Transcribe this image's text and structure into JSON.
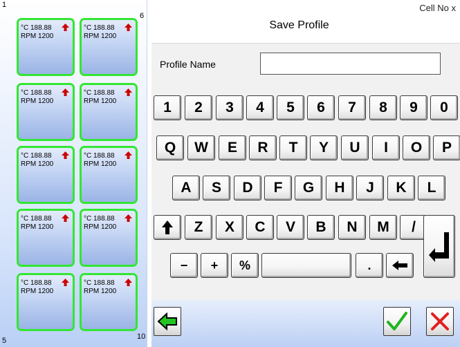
{
  "left_panel": {
    "corner_labels": {
      "top_left": "1",
      "top_right": "6",
      "bottom_left": "5",
      "bottom_right": "10"
    },
    "cells": [
      {
        "temp": "°C 188.88",
        "rpm": "RPM 1200"
      },
      {
        "temp": "°C 188.88",
        "rpm": "RPM 1200"
      },
      {
        "temp": "°C 188.88",
        "rpm": "RPM 1200"
      },
      {
        "temp": "°C 188.88",
        "rpm": "RPM 1200"
      },
      {
        "temp": "°C 188.88",
        "rpm": "RPM 1200"
      },
      {
        "temp": "°C 188.88",
        "rpm": "RPM 1200"
      },
      {
        "temp": "°C 188.88",
        "rpm": "RPM 1200"
      },
      {
        "temp": "°C 188.88",
        "rpm": "RPM 1200"
      },
      {
        "temp": "°C 188.88",
        "rpm": "RPM 1200"
      },
      {
        "temp": "°C 188.88",
        "rpm": "RPM 1200"
      }
    ],
    "cell_border_color": "#33e633",
    "arrow_color": "#cc0000"
  },
  "dialog": {
    "cell_no": "Cell No  x",
    "title": "Save Profile",
    "profile_label": "Profile Name",
    "profile_value": "",
    "keyboard": {
      "row1": [
        "1",
        "2",
        "3",
        "4",
        "5",
        "6",
        "7",
        "8",
        "9",
        "0"
      ],
      "row2": [
        "Q",
        "W",
        "E",
        "R",
        "T",
        "Y",
        "U",
        "I",
        "O",
        "P"
      ],
      "row3": [
        "A",
        "S",
        "D",
        "F",
        "G",
        "H",
        "J",
        "K",
        "L"
      ],
      "row4": [
        "Z",
        "X",
        "C",
        "V",
        "B",
        "N",
        "M",
        "/"
      ],
      "row5": [
        "−",
        "+",
        "%",
        "."
      ]
    },
    "icons": {
      "shift": "shift-arrow-icon",
      "space": "space-key",
      "backspace": "backspace-arrow-icon",
      "enter": "enter-return-icon",
      "back": "back-arrow-icon",
      "ok": "checkmark-icon",
      "cancel": "cross-icon"
    },
    "colors": {
      "back_green": "#22c422",
      "ok_green": "#22b422",
      "cancel_red": "#e02020"
    }
  }
}
